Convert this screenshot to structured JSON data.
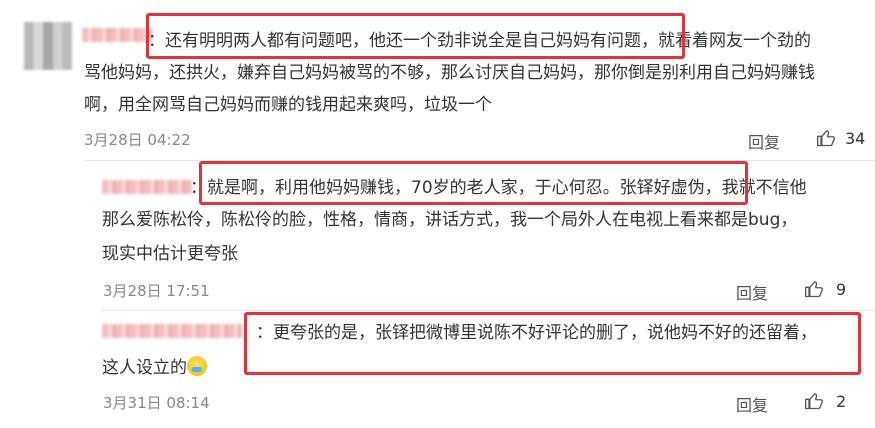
{
  "comments": [
    {
      "line1": "：还有明明两人都有问题吧，他还一个劲非说全是自己妈妈有问题，就看着网友一个劲的",
      "line2": "骂他妈妈，还拱火，嫌弃自己妈妈被骂的不够，那么讨厌自己妈妈，那你倒是别利用自己妈妈赚钱",
      "line3": "啊，用全网骂自己妈妈而赚的钱用起来爽吗，垃圾一个",
      "time": "3月28日 04:22",
      "reply": "回复",
      "likes": "34"
    },
    {
      "line1": "：就是啊，利用他妈妈赚钱，70岁的老人家，于心何忍。张铎好虚伪，我就不信他",
      "line2": "那么爱陈松伶，陈松伶的脸，性格，情商，讲话方式，我一个局外人在电视上看来都是bug，",
      "line3": "现实中估计更夸张",
      "time": "3月28日 17:51",
      "reply": "回复",
      "likes": "9"
    },
    {
      "line1": "：更夸张的是，张铎把微博里说陈不好评论的删了，说他妈不好的还留着，",
      "line2": "这人设立的",
      "time": "3月31日 08:14",
      "reply": "回复",
      "likes": "2"
    }
  ],
  "icons": {
    "thumb": "thumbs-up-icon",
    "emoji": "crying-laughing-emoji-icon"
  },
  "colors": {
    "highlight": "#e0333c",
    "meta": "#888888"
  }
}
